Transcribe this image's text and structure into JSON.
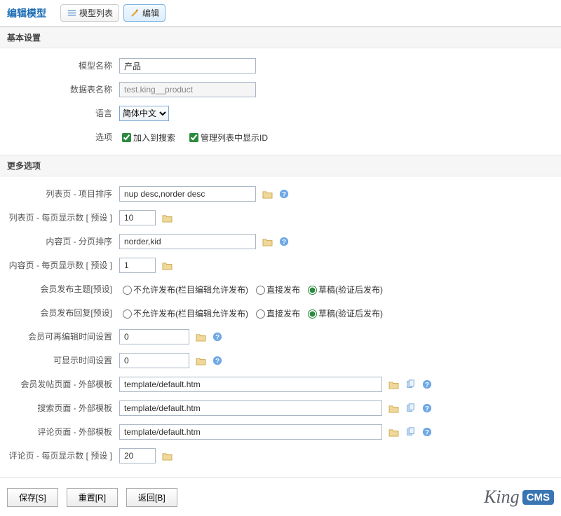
{
  "header": {
    "title": "编辑模型",
    "nav_list": "模型列表",
    "nav_edit": "编辑"
  },
  "sections": {
    "basic": "基本设置",
    "more": "更多选项"
  },
  "basic": {
    "model_name_label": "模型名称",
    "model_name_value": "产品",
    "table_name_label": "数据表名称",
    "table_name_value": "test.king__product",
    "language_label": "语言",
    "language_value": "简体中文",
    "options_label": "选项",
    "opt_search": "加入到搜索",
    "opt_showid": "管理列表中显示ID"
  },
  "more": {
    "list_sort_label": "列表页  -  项目排序",
    "list_sort_value": "nup desc,norder desc",
    "list_perpage_label": "列表页  -  每页显示数 [ 预设 ]",
    "list_perpage_value": "10",
    "content_sort_label": "内容页  -  分页排序",
    "content_sort_value": "norder,kid",
    "content_perpage_label": "内容页  -  每页显示数 [ 预设 ]",
    "content_perpage_value": "1",
    "member_post_label": "会员发布主题[预设]",
    "member_reply_label": "会员发布回复[预设]",
    "radio_no": "不允许发布(栏目编辑允许发布)",
    "radio_direct": "直接发布",
    "radio_draft": "草稿(验证后发布)",
    "reedit_time_label": "会员可再编辑时间设置",
    "reedit_time_value": "0",
    "display_time_label": "可显示时间设置",
    "display_time_value": "0",
    "post_tpl_label": "会员发帖页面  -  外部模板",
    "post_tpl_value": "template/default.htm",
    "search_tpl_label": "搜索页面  -  外部模板",
    "search_tpl_value": "template/default.htm",
    "comment_tpl_label": "评论页面  -  外部模板",
    "comment_tpl_value": "template/default.htm",
    "comment_perpage_label": "评论页  -  每页显示数 [ 预设 ]",
    "comment_perpage_value": "20"
  },
  "buttons": {
    "save": "保存[S]",
    "reset": "重置[R]",
    "back": "返回[B]"
  },
  "brand": {
    "king": "King",
    "cms": "CMS"
  }
}
